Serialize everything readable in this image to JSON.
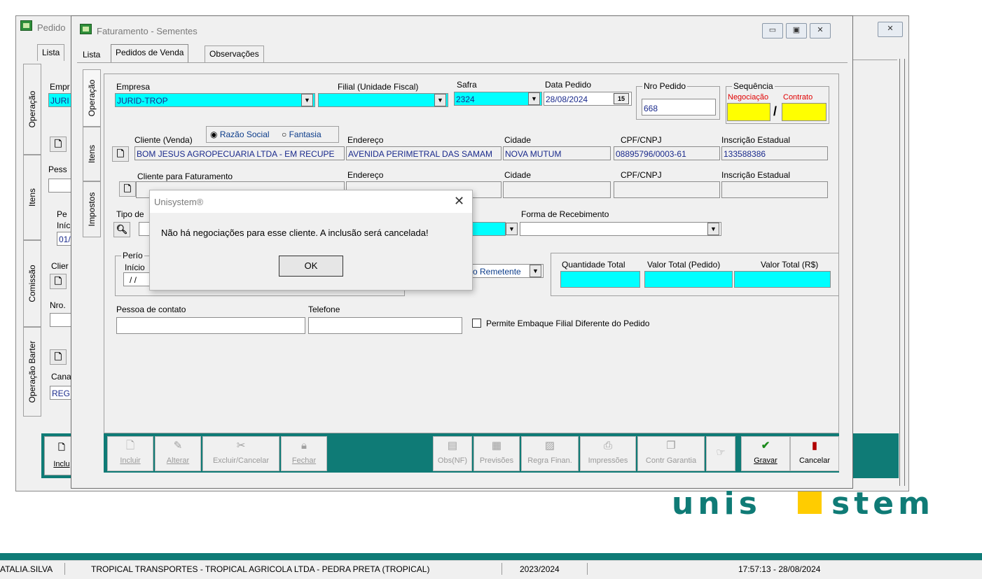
{
  "back_window": {
    "title": "Pedido",
    "tab_lista": "Lista",
    "side_tabs": [
      "Operação",
      "Itens",
      "Comissão",
      "Operação Barter"
    ],
    "labels": {
      "empresa": "Empr",
      "empresa_value": "JURI",
      "pessoa": "Pess",
      "periodo": "Pe",
      "inicio": "Iníc",
      "inicio_value": "01/",
      "cliente": "Clier",
      "nro": "Nro.",
      "canal": "Cana",
      "canal_value": "REG"
    },
    "include_label": "Inclu"
  },
  "main_window": {
    "title": "Faturamento - Sementes",
    "tabs": [
      "Lista",
      "Pedidos de Venda",
      "Observações"
    ],
    "side_tabs": [
      "Operação",
      "Itens",
      "Impostos"
    ],
    "empresa": {
      "label": "Empresa",
      "value": "JURID-TROP"
    },
    "filial": {
      "label": "Filial (Unidade Fiscal)",
      "value": ""
    },
    "safra": {
      "label": "Safra",
      "value": "2324"
    },
    "data_pedido": {
      "label": "Data Pedido",
      "value": "28/08/2024"
    },
    "nro_pedido": {
      "label": "Nro Pedido",
      "value": "668"
    },
    "sequencia": {
      "label": "Sequência",
      "negociacao": "Negociação",
      "contrato": "Contrato",
      "slash": "/"
    },
    "cliente_venda": {
      "label": "Cliente (Venda)",
      "radio1": "Razão Social",
      "radio2": "Fantasia",
      "value": "BOM JESUS AGROPECUARIA LTDA - EM RECUPE",
      "endereco_label": "Endereço",
      "endereco": "AVENIDA PERIMETRAL DAS SAMAM",
      "cidade_label": "Cidade",
      "cidade": "NOVA MUTUM",
      "cpf_label": "CPF/CNPJ",
      "cpf": "08895796/0003-61",
      "ie_label": "Inscrição Estadual",
      "ie": "133588386"
    },
    "cliente_fat": {
      "label": "Cliente para Faturamento",
      "endereco_label": "Endereço",
      "cidade_label": "Cidade",
      "cpf_label": "CPF/CNPJ",
      "ie_label": "Inscrição Estadual"
    },
    "tipo_label": "Tipo de",
    "forma_recebimento_label": "Forma de Recebimento",
    "periodo_label": "Perío",
    "inicio_label": "Início",
    "inicio_value": "/ /",
    "remetente_value": "o Remetente",
    "totals": {
      "qtd": "Quantidade Total",
      "valor_pedido": "Valor Total (Pedido)",
      "valor_rs": "Valor Total (R$)"
    },
    "pessoa_contato_label": "Pessoa de contato",
    "telefone_label": "Telefone",
    "permite_label": "Permite Embaque Filial Diferente do Pedido",
    "toolbar": {
      "incluir": "Incluir",
      "alterar": "Alterar",
      "excluir": "Excluir/Cancelar",
      "fechar": "Fechar",
      "obs": "Obs(NF)",
      "previsoes": "Previsões",
      "regra": "Regra Finan.",
      "impressoes": "Impressões",
      "contr": "Contr Garantia",
      "gravar": "Gravar",
      "cancelar": "Cancelar"
    }
  },
  "dialog": {
    "title": "Unisystem®",
    "message": "Não há negociações para esse cliente. A inclusão será cancelada!",
    "ok": "OK"
  },
  "brand": "unisystem",
  "statusbar": {
    "user": "ATALIA.SILVA",
    "company": "TROPICAL TRANSPORTES - TROPICAL AGRICOLA LTDA - PEDRA PRETA (TROPICAL)",
    "safra": "2023/2024",
    "datetime": "17:57:13 - 28/08/2024"
  },
  "colors": {
    "teal": "#0f7b76",
    "cyan": "#00ffff",
    "yellow": "#ffff00",
    "red_label": "#e00000"
  }
}
